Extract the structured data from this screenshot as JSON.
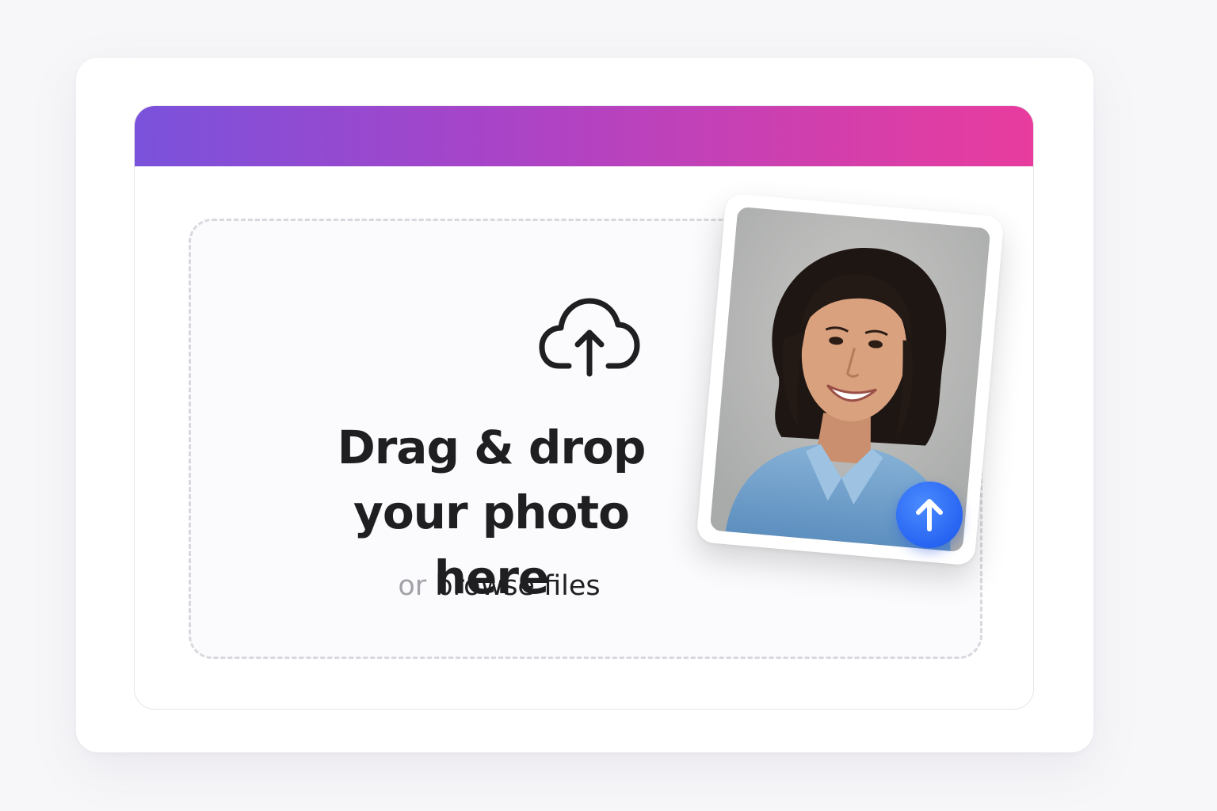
{
  "header": {
    "gradient_start": "#7a52db",
    "gradient_end": "#e83c9e"
  },
  "dropzone": {
    "icon": "cloud-upload-icon",
    "headline_line1": "Drag & drop",
    "headline_line2": "your photo here",
    "browse_prefix": "or",
    "browse_link": "browse files"
  },
  "preview": {
    "type": "photo",
    "badge_icon": "arrow-up-icon",
    "badge_color": "#2765f2"
  }
}
